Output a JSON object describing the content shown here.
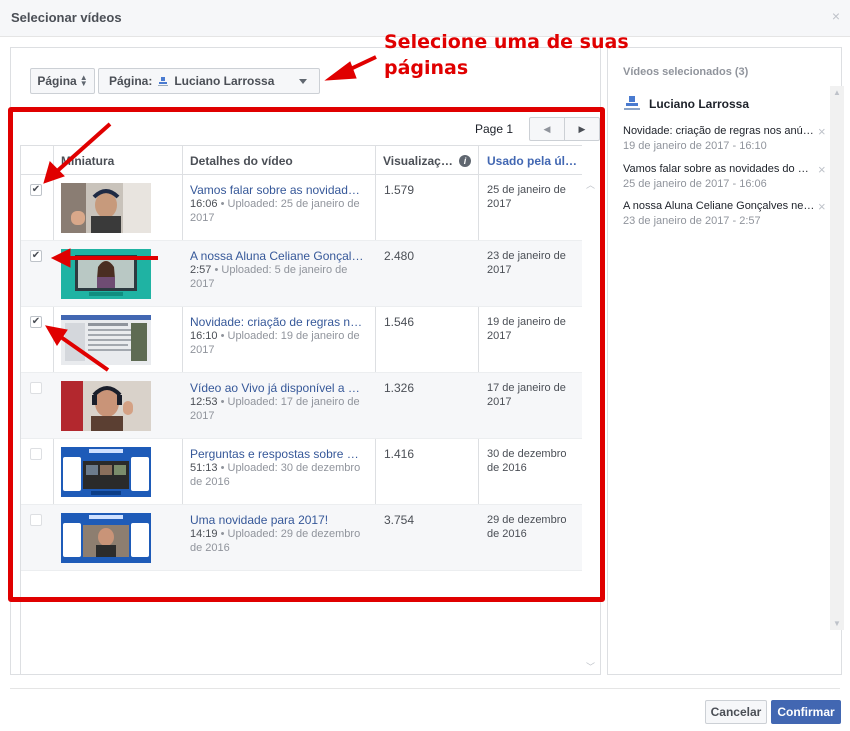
{
  "dialog": {
    "title": "Selecionar vídeos",
    "close_glyph": "×"
  },
  "toolbar": {
    "sort_label": "Página",
    "page_select_label": "Página:",
    "page_select_value": "Luciano Larrossa"
  },
  "pager": {
    "label": "Page 1",
    "prev_glyph": "◀",
    "next_glyph": "▶"
  },
  "table": {
    "columns": [
      "Miniatura",
      "Detalhes do vídeo",
      "Visualizaç…",
      "Usado pela úl…"
    ],
    "rows": [
      {
        "checked": true,
        "check_glyph": "✔",
        "title": "Vamos falar sobre as novidades do Facebook",
        "duration": "16:06",
        "uploaded": " • Uploaded: 25 de janeiro de 2017",
        "views": "1.579",
        "used": "25 de janeiro de 2017",
        "thumb": "man-headphones"
      },
      {
        "checked": true,
        "check_glyph": "✔",
        "title": "A nossa Aluna Celiane Gonçalves nesta",
        "duration": "2:57",
        "uploaded": " • Uploaded: 5 de janeiro de 2017",
        "views": "2.480",
        "used": "23 de janeiro de 2017",
        "thumb": "woman-teal"
      },
      {
        "checked": true,
        "check_glyph": "✔",
        "title": "Novidade: criação de regras nos anúncios",
        "duration": "16:10",
        "uploaded": " • Uploaded: 19 de janeiro de 2017",
        "views": "1.546",
        "used": "19 de janeiro de 2017",
        "thumb": "screenshot-doc"
      },
      {
        "checked": false,
        "check_glyph": "",
        "title": "Vídeo ao Vivo já disponível a partir do",
        "duration": "12:53",
        "uploaded": " • Uploaded: 17 de janeiro de 2017",
        "views": "1.326",
        "used": "17 de janeiro de 2017",
        "thumb": "man-red"
      },
      {
        "checked": false,
        "check_glyph": "",
        "title": "Perguntas e respostas sobre Facebook",
        "duration": "51:13",
        "uploaded": " • Uploaded: 30 de dezembro de 2016",
        "views": "1.416",
        "used": "30 de dezembro de 2016",
        "thumb": "promo-blue-dark"
      },
      {
        "checked": false,
        "check_glyph": "",
        "title": "Uma novidade para 2017!",
        "duration": "14:19",
        "uploaded": " • Uploaded: 29 de dezembro de 2016",
        "views": "3.754",
        "used": "29 de dezembro de 2016",
        "thumb": "promo-blue-man"
      }
    ]
  },
  "selected": {
    "title": "Vídeos selecionados (3)",
    "page_name": "Luciano Larrossa",
    "remove_glyph": "×",
    "items": [
      {
        "title": "Novidade: criação de regras nos anúncios",
        "date": "19 de janeiro de 2017 - 16:10"
      },
      {
        "title": "Vamos falar sobre as novidades do Facebook",
        "date": "25 de janeiro de 2017 - 16:06"
      },
      {
        "title": "A nossa Aluna Celiane Gonçalves nesta",
        "date": "23 de janeiro de 2017 - 2:57"
      }
    ]
  },
  "footer": {
    "cancel_label": "Cancelar",
    "confirm_label": "Confirmar"
  },
  "annotation": {
    "line1": "Selecione uma de suas",
    "line2": "páginas",
    "color": "#e00000"
  },
  "colors": {
    "link": "#365899",
    "brand": "#4267b2",
    "annotation": "#e00000"
  }
}
